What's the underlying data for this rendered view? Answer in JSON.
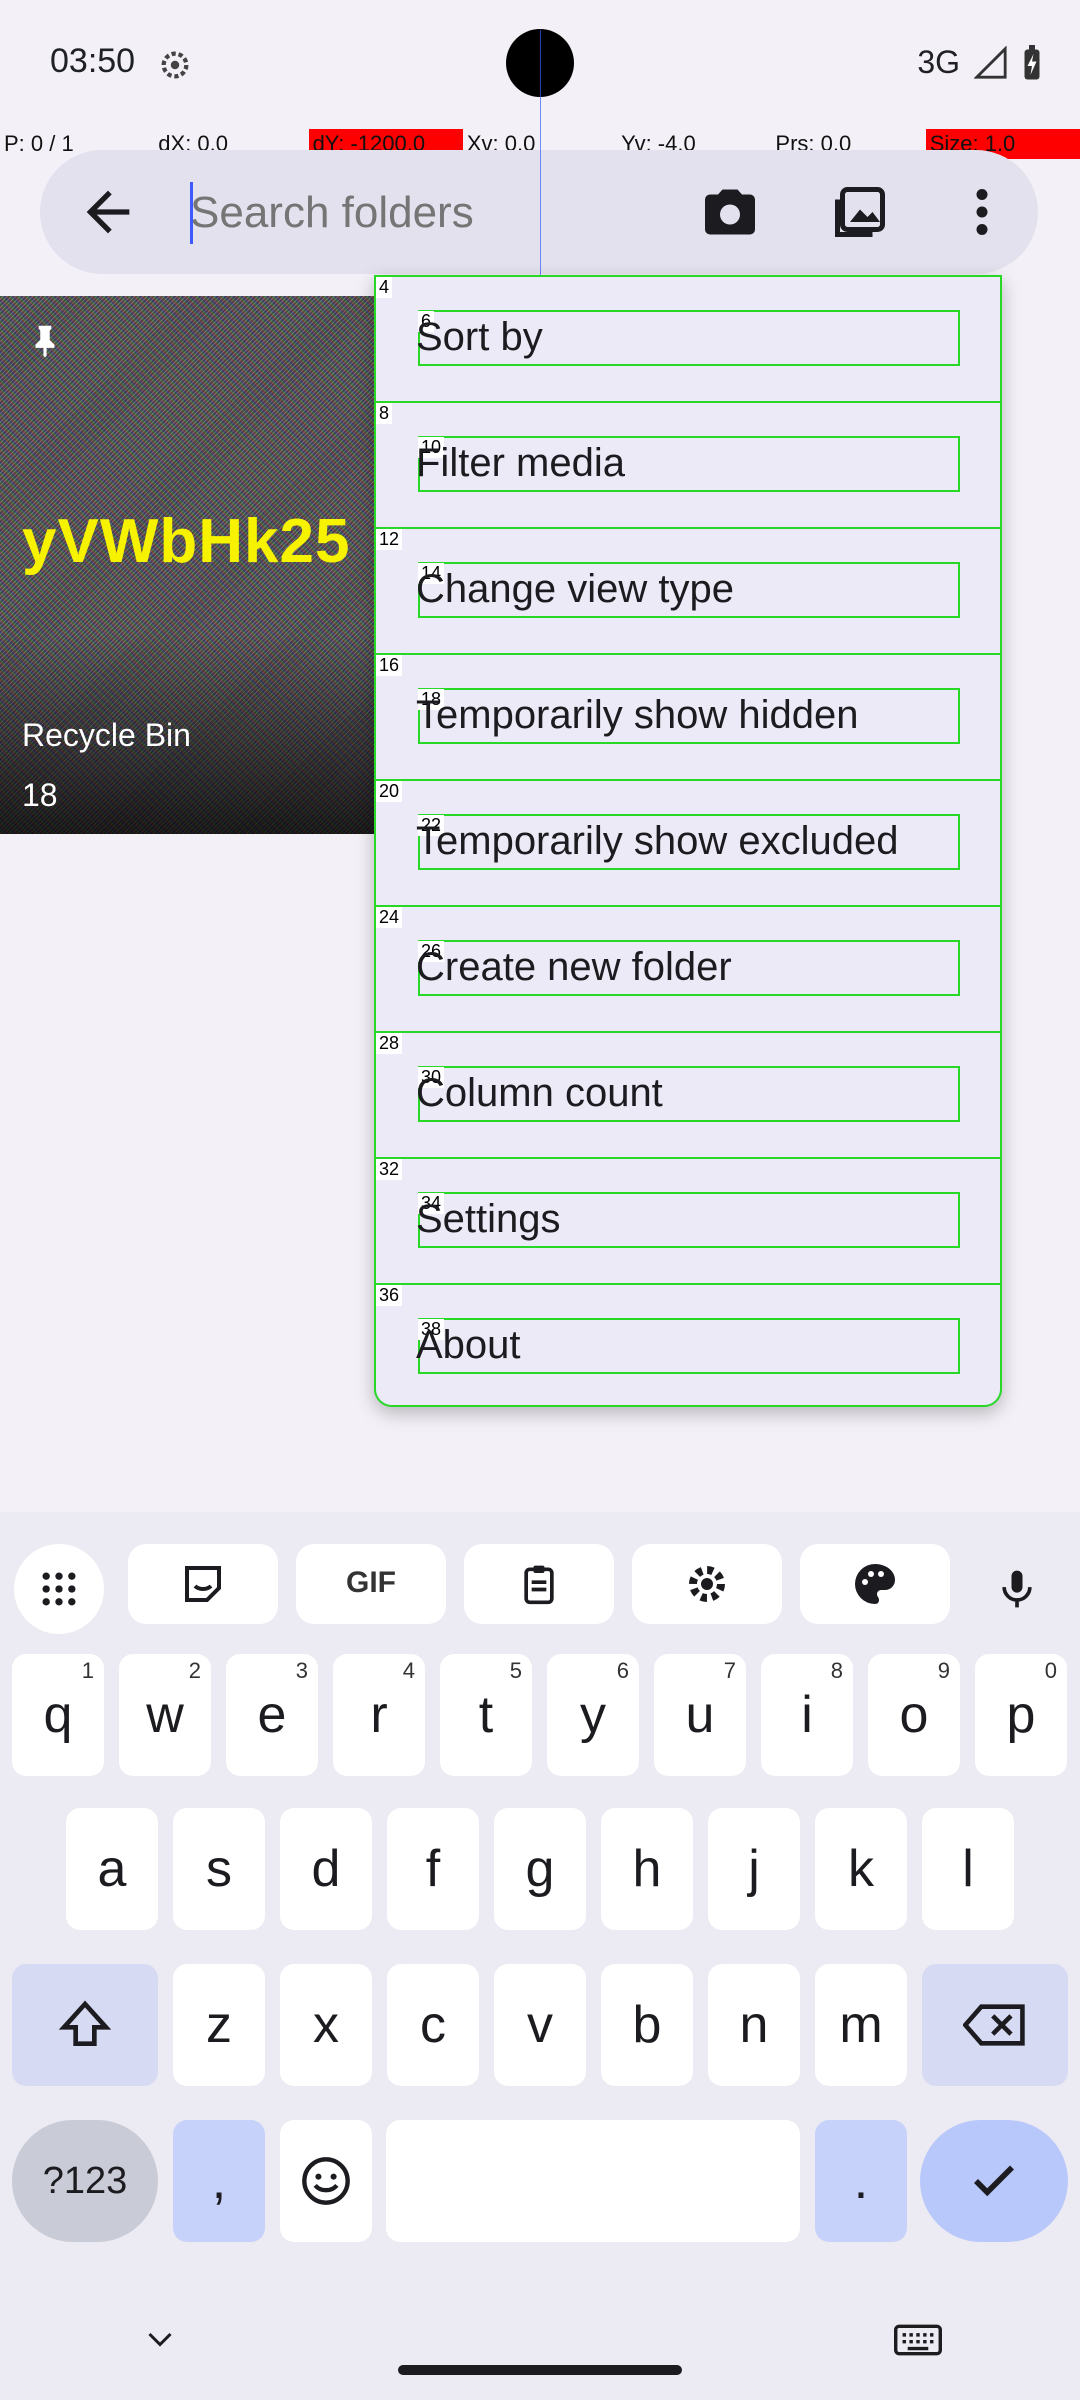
{
  "status_bar": {
    "time": "03:50",
    "network": "3G"
  },
  "pointer_overlay": {
    "cells": [
      "P: 0 / 1",
      "dX: 0.0",
      "dY: -1200.0",
      "Xv: 0.0",
      "Yv: -4.0",
      "Prs: 0.0",
      "Size: 1.0"
    ]
  },
  "search": {
    "placeholder": "Search folders"
  },
  "folder": {
    "name": "Recycle Bin",
    "count": "18",
    "thumbnail_text": "yVWbHk25"
  },
  "menu": {
    "items": [
      {
        "label": "Sort by",
        "outer_index": "4",
        "inner_index": "6"
      },
      {
        "label": "Filter media",
        "outer_index": "8",
        "inner_index": "10"
      },
      {
        "label": "Change view type",
        "outer_index": "12",
        "inner_index": "14"
      },
      {
        "label": "Temporarily show hidden",
        "outer_index": "16",
        "inner_index": "18"
      },
      {
        "label": "Temporarily show excluded",
        "outer_index": "20",
        "inner_index": "22"
      },
      {
        "label": "Create new folder",
        "outer_index": "24",
        "inner_index": "26"
      },
      {
        "label": "Column count",
        "outer_index": "28",
        "inner_index": "30"
      },
      {
        "label": "Settings",
        "outer_index": "32",
        "inner_index": "34"
      },
      {
        "label": "About",
        "outer_index": "36",
        "inner_index": "38"
      }
    ]
  },
  "keyboard": {
    "toolbar": {
      "gif": "GIF"
    },
    "row1": [
      {
        "k": "q",
        "h": "1"
      },
      {
        "k": "w",
        "h": "2"
      },
      {
        "k": "e",
        "h": "3"
      },
      {
        "k": "r",
        "h": "4"
      },
      {
        "k": "t",
        "h": "5"
      },
      {
        "k": "y",
        "h": "6"
      },
      {
        "k": "u",
        "h": "7"
      },
      {
        "k": "i",
        "h": "8"
      },
      {
        "k": "o",
        "h": "9"
      },
      {
        "k": "p",
        "h": "0"
      }
    ],
    "row2": [
      "a",
      "s",
      "d",
      "f",
      "g",
      "h",
      "j",
      "k",
      "l"
    ],
    "row3": [
      "z",
      "x",
      "c",
      "v",
      "b",
      "n",
      "m"
    ],
    "symbols": "?123",
    "comma": ",",
    "period": "."
  },
  "colors": {
    "accent": "#3b5bff",
    "highlight": "#27d827",
    "search_bg": "#e3e1ed"
  }
}
